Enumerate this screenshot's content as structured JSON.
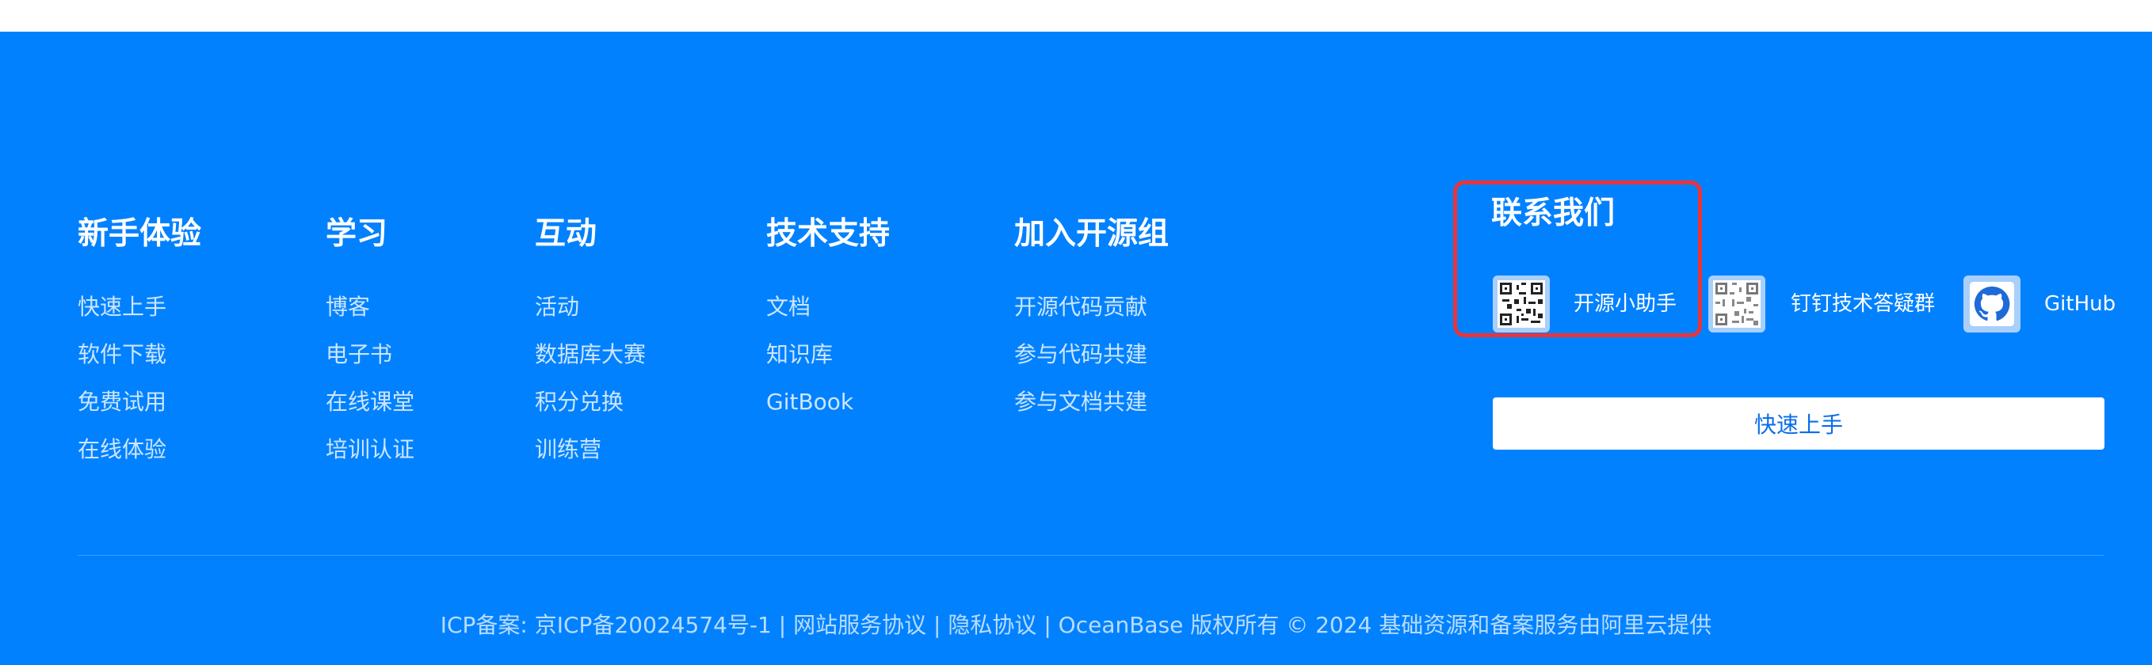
{
  "columns": [
    {
      "title": "新手体验",
      "links": [
        "快速上手",
        "软件下载",
        "免费试用",
        "在线体验"
      ]
    },
    {
      "title": "学习",
      "links": [
        "博客",
        "电子书",
        "在线课堂",
        "培训认证"
      ]
    },
    {
      "title": "互动",
      "links": [
        "活动",
        "数据库大赛",
        "积分兑换",
        "训练营"
      ]
    },
    {
      "title": "技术支持",
      "links": [
        "文档",
        "知识库",
        "GitBook"
      ]
    },
    {
      "title": "加入开源组",
      "links": [
        "开源代码贡献",
        "参与代码共建",
        "参与文档共建"
      ]
    }
  ],
  "contact": {
    "title": "联系我们",
    "items": [
      {
        "label": "开源小助手",
        "icon": "qr-code-icon"
      },
      {
        "label": "钉钉技术答疑群",
        "icon": "qr-code-icon"
      },
      {
        "label": "GitHub",
        "icon": "github-icon"
      }
    ],
    "cta_label": "快速上手"
  },
  "copyright": {
    "icp": "ICP备案: 京ICP备20024574号-1",
    "sep": "|",
    "terms": "网站服务协议",
    "privacy": "隐私协议",
    "rights": "OceanBase 版权所有 © 2024 基础资源和备案服务由阿里云提供"
  },
  "colors": {
    "footer_bg": "#0281fe",
    "highlight": "#e8343a",
    "button_text": "#0a6ee8"
  }
}
